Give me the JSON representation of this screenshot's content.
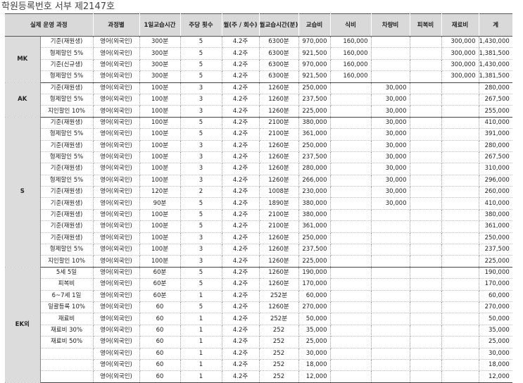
{
  "title": "학원등록번호 서부 제2147호",
  "columns": [
    "실제 운영 과정",
    "과정별",
    "1일교습시간",
    "주당 횟수",
    "월(주 / 회수)",
    "월교습시간(분)",
    "교습비",
    "식비",
    "차량비",
    "피복비",
    "재료비",
    "계"
  ],
  "groups": [
    {
      "name": "MK",
      "rows": [
        [
          "기준(재원생)",
          "영어(외국인)",
          "300분",
          "5",
          "4.2주",
          "6300분",
          "970,000",
          "160,000",
          "",
          "",
          "300,000",
          "1,430,000"
        ],
        [
          "형제할인 5%",
          "영어(외국인)",
          "300분",
          "5",
          "4.2주",
          "6300분",
          "921,500",
          "160,000",
          "",
          "",
          "300,000",
          "1,381,500"
        ],
        [
          "기준(신규생)",
          "영어(외국인)",
          "300분",
          "5",
          "4.2주",
          "6300분",
          "970,000",
          "160,000",
          "",
          "",
          "300,000",
          "1,430,000"
        ],
        [
          "형제할인 5%",
          "영어(외국인)",
          "300분",
          "5",
          "4.2주",
          "6300분",
          "921,500",
          "160,000",
          "",
          "",
          "300,000",
          "1,381,500"
        ]
      ]
    },
    {
      "name": "AK",
      "rows": [
        [
          "기준(재원생)",
          "영어(외국인)",
          "100분",
          "3",
          "4.2주",
          "1260분",
          "250,000",
          "",
          "30,000",
          "",
          "",
          "280,000"
        ],
        [
          "형제할인 5%",
          "영어(외국인)",
          "100분",
          "3",
          "4.2주",
          "1260분",
          "237,500",
          "",
          "30,000",
          "",
          "",
          "267,500"
        ],
        [
          "지인할인 10%",
          "영어(외국인)",
          "100분",
          "3",
          "4.2주",
          "1260분",
          "225,000",
          "",
          "30,000",
          "",
          "",
          "255,000"
        ]
      ]
    },
    {
      "name": "S",
      "rows": [
        [
          "기준(재원생)",
          "영어(외국인)",
          "100분",
          "5",
          "4.2주",
          "2100분",
          "380,000",
          "",
          "30,000",
          "",
          "",
          "410,000"
        ],
        [
          "형제할인 5%",
          "영어(외국인)",
          "100분",
          "5",
          "4.2주",
          "2100분",
          "361,000",
          "",
          "30,000",
          "",
          "",
          "391,000"
        ],
        [
          "기준(재원생)",
          "영어(외국인)",
          "100분",
          "3",
          "4.2주",
          "1260분",
          "250,000",
          "",
          "30,000",
          "",
          "",
          "280,000"
        ],
        [
          "형제할인 5%",
          "영어(외국인)",
          "100분",
          "3",
          "4.2주",
          "1260분",
          "237,500",
          "",
          "30,000",
          "",
          "",
          "267,500"
        ],
        [
          "기준(재원생)",
          "영어(외국인)",
          "100분",
          "3",
          "4.2주",
          "1260분",
          "280,000",
          "",
          "30,000",
          "",
          "",
          "310,000"
        ],
        [
          "형제할인 5%",
          "영어(외국인)",
          "100분",
          "3",
          "4.2주",
          "1260분",
          "266,000",
          "",
          "30,000",
          "",
          "",
          "296,000"
        ],
        [
          "기준(재원생)",
          "영어(외국인)",
          "120분",
          "2",
          "4.2주",
          "1008분",
          "230,000",
          "",
          "30,000",
          "",
          "",
          "260,000"
        ],
        [
          "기준(재원생)",
          "영어(외국인)",
          "90분",
          "5",
          "4.2주",
          "1890분",
          "380,000",
          "",
          "30,000",
          "",
          "",
          "410,000"
        ],
        [
          "기준(재원생)",
          "영어(외국인)",
          "100분",
          "5",
          "4.2주",
          "2100분",
          "380,000",
          "",
          "",
          "",
          "",
          "380,000"
        ],
        [
          "기준(재원생)",
          "영어(외국인)",
          "100분",
          "5",
          "4.2주",
          "2100분",
          "361,000",
          "",
          "",
          "",
          "",
          "361,000"
        ],
        [
          "기준(재원생)",
          "영어(외국인)",
          "100분",
          "3",
          "4.2주",
          "1260분",
          "250,000",
          "",
          "",
          "",
          "",
          "250,000"
        ],
        [
          "형제할인 5%",
          "영어(외국인)",
          "100분",
          "3",
          "4.2주",
          "1260분",
          "237,500",
          "",
          "",
          "",
          "",
          "237,500"
        ],
        [
          "지인할인 10%",
          "영어(외국인)",
          "100분",
          "3",
          "4.2주",
          "1260분",
          "225,000",
          "",
          "",
          "",
          "",
          "225,000"
        ]
      ]
    },
    {
      "name": "EK외",
      "rows": [
        [
          "5세 5일",
          "영어(외국인)",
          "60분",
          "5",
          "4.2주",
          "1260분",
          "190,000",
          "",
          "",
          "",
          "",
          "190,000"
        ],
        [
          "피복비",
          "영어(외국인)",
          "60분",
          "5",
          "4.2주",
          "1260분",
          "170,000",
          "",
          "",
          "",
          "",
          "170,000"
        ],
        [
          "6~7세 1일",
          "영어(외국인)",
          "60분",
          "1",
          "4.2주",
          "252분",
          "60,000",
          "",
          "",
          "",
          "",
          "60,000"
        ],
        [
          "일괄등록 10%",
          "영어(외국인)",
          "60",
          "5",
          "4.2주",
          "1260분",
          "270,000",
          "",
          "",
          "",
          "",
          "270,000"
        ],
        [
          "재료비",
          "영어(외국인)",
          "60",
          "1",
          "4.2주",
          "252분",
          "50,000",
          "",
          "",
          "",
          "",
          "50,000"
        ],
        [
          "재료비 30%",
          "영어(외국인)",
          "60",
          "1",
          "4.2주",
          "252",
          "35,000",
          "",
          "",
          "",
          "",
          "35,000"
        ],
        [
          "재료비 50%",
          "영어(외국인)",
          "60",
          "1",
          "4.2주",
          "252",
          "25,000",
          "",
          "",
          "",
          "",
          "25,000"
        ],
        [
          "",
          "영어(외국인)",
          "60",
          "1",
          "4.2주",
          "252",
          "30,000",
          "",
          "",
          "",
          "",
          "30,000"
        ],
        [
          "",
          "영어(외국인)",
          "60",
          "1",
          "4.2주",
          "252",
          "18,000",
          "",
          "",
          "",
          "",
          "18,000"
        ],
        [
          "",
          "영어(외국인)",
          "60",
          "1",
          "4.2주",
          "252",
          "12,000",
          "",
          "",
          "",
          "",
          "12,000"
        ]
      ]
    }
  ]
}
